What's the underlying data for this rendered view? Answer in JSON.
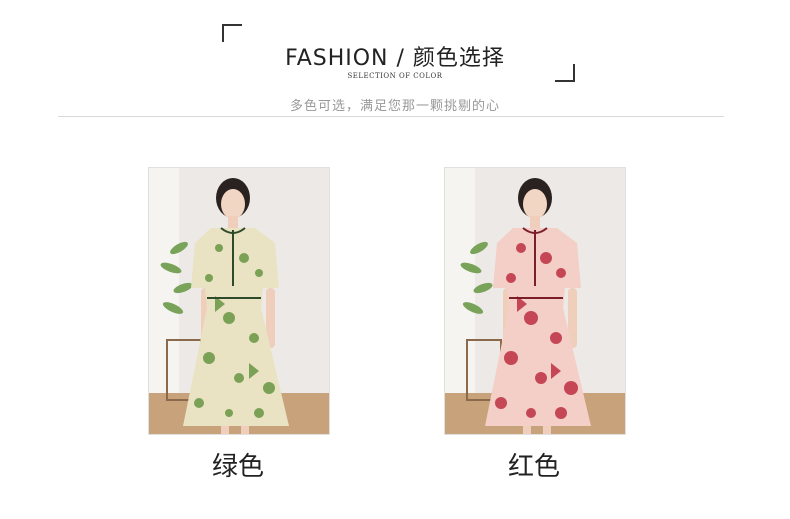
{
  "header": {
    "title": "FASHION / 颜色选择",
    "subtitle": "SELECTION OF COLOR",
    "tagline": "多色可选，满足您那一颗挑剔的心"
  },
  "products": [
    {
      "label": "绿色",
      "dress_color": "#e9e3c3",
      "pattern_color": "#6f9a4a",
      "trim_color": "#2f4a2a"
    },
    {
      "label": "红色",
      "dress_color": "#f4cfc8",
      "pattern_color": "#c0394a",
      "trim_color": "#7a1e2a"
    }
  ]
}
